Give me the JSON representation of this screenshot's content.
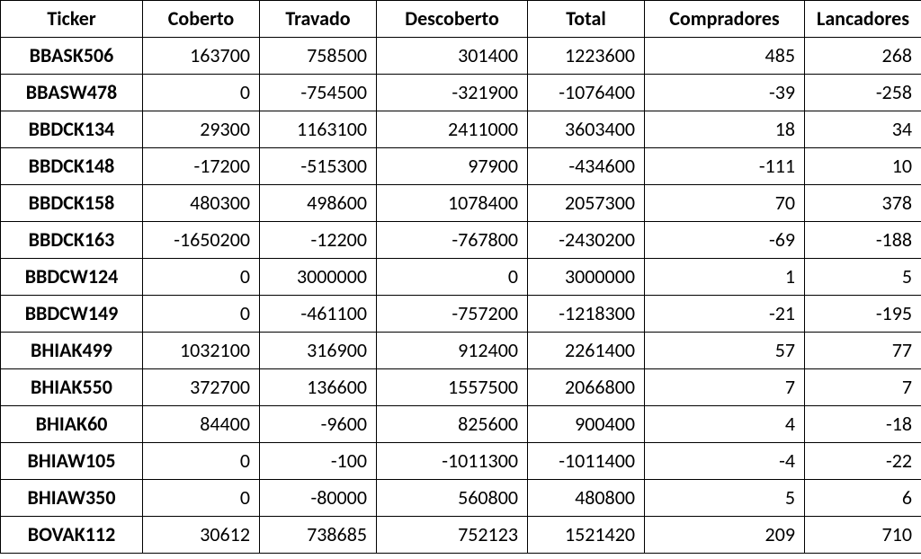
{
  "headers": {
    "ticker": "Ticker",
    "coberto": "Coberto",
    "travado": "Travado",
    "descoberto": "Descoberto",
    "total": "Total",
    "compradores": "Compradores",
    "lancadores": "Lancadores"
  },
  "rows": [
    {
      "ticker": "BBASK506",
      "coberto": "163700",
      "travado": "758500",
      "descoberto": "301400",
      "total": "1223600",
      "compradores": "485",
      "lancadores": "268"
    },
    {
      "ticker": "BBASW478",
      "coberto": "0",
      "travado": "-754500",
      "descoberto": "-321900",
      "total": "-1076400",
      "compradores": "-39",
      "lancadores": "-258"
    },
    {
      "ticker": "BBDCK134",
      "coberto": "29300",
      "travado": "1163100",
      "descoberto": "2411000",
      "total": "3603400",
      "compradores": "18",
      "lancadores": "34"
    },
    {
      "ticker": "BBDCK148",
      "coberto": "-17200",
      "travado": "-515300",
      "descoberto": "97900",
      "total": "-434600",
      "compradores": "-111",
      "lancadores": "10"
    },
    {
      "ticker": "BBDCK158",
      "coberto": "480300",
      "travado": "498600",
      "descoberto": "1078400",
      "total": "2057300",
      "compradores": "70",
      "lancadores": "378"
    },
    {
      "ticker": "BBDCK163",
      "coberto": "-1650200",
      "travado": "-12200",
      "descoberto": "-767800",
      "total": "-2430200",
      "compradores": "-69",
      "lancadores": "-188"
    },
    {
      "ticker": "BBDCW124",
      "coberto": "0",
      "travado": "3000000",
      "descoberto": "0",
      "total": "3000000",
      "compradores": "1",
      "lancadores": "5"
    },
    {
      "ticker": "BBDCW149",
      "coberto": "0",
      "travado": "-461100",
      "descoberto": "-757200",
      "total": "-1218300",
      "compradores": "-21",
      "lancadores": "-195"
    },
    {
      "ticker": "BHIAK499",
      "coberto": "1032100",
      "travado": "316900",
      "descoberto": "912400",
      "total": "2261400",
      "compradores": "57",
      "lancadores": "77"
    },
    {
      "ticker": "BHIAK550",
      "coberto": "372700",
      "travado": "136600",
      "descoberto": "1557500",
      "total": "2066800",
      "compradores": "7",
      "lancadores": "7"
    },
    {
      "ticker": "BHIAK60",
      "coberto": "84400",
      "travado": "-9600",
      "descoberto": "825600",
      "total": "900400",
      "compradores": "4",
      "lancadores": "-18"
    },
    {
      "ticker": "BHIAW105",
      "coberto": "0",
      "travado": "-100",
      "descoberto": "-1011300",
      "total": "-1011400",
      "compradores": "-4",
      "lancadores": "-22"
    },
    {
      "ticker": "BHIAW350",
      "coberto": "0",
      "travado": "-80000",
      "descoberto": "560800",
      "total": "480800",
      "compradores": "5",
      "lancadores": "6"
    },
    {
      "ticker": "BOVAK112",
      "coberto": "30612",
      "travado": "738685",
      "descoberto": "752123",
      "total": "1521420",
      "compradores": "209",
      "lancadores": "710"
    }
  ],
  "chart_data": {
    "type": "table",
    "columns": [
      "Ticker",
      "Coberto",
      "Travado",
      "Descoberto",
      "Total",
      "Compradores",
      "Lancadores"
    ],
    "data": [
      [
        "BBASK506",
        163700,
        758500,
        301400,
        1223600,
        485,
        268
      ],
      [
        "BBASW478",
        0,
        -754500,
        -321900,
        -1076400,
        -39,
        -258
      ],
      [
        "BBDCK134",
        29300,
        1163100,
        2411000,
        3603400,
        18,
        34
      ],
      [
        "BBDCK148",
        -17200,
        -515300,
        97900,
        -434600,
        -111,
        10
      ],
      [
        "BBDCK158",
        480300,
        498600,
        1078400,
        2057300,
        70,
        378
      ],
      [
        "BBDCK163",
        -1650200,
        -12200,
        -767800,
        -2430200,
        -69,
        -188
      ],
      [
        "BBDCW124",
        0,
        3000000,
        0,
        3000000,
        1,
        5
      ],
      [
        "BBDCW149",
        0,
        -461100,
        -757200,
        -1218300,
        -21,
        -195
      ],
      [
        "BHIAK499",
        1032100,
        316900,
        912400,
        2261400,
        57,
        77
      ],
      [
        "BHIAK550",
        372700,
        136600,
        1557500,
        2066800,
        7,
        7
      ],
      [
        "BHIAK60",
        84400,
        -9600,
        825600,
        900400,
        4,
        -18
      ],
      [
        "BHIAW105",
        0,
        -100,
        -1011300,
        -1011400,
        -4,
        -22
      ],
      [
        "BHIAW350",
        0,
        -80000,
        560800,
        480800,
        5,
        6
      ],
      [
        "BOVAK112",
        30612,
        738685,
        752123,
        1521420,
        209,
        710
      ]
    ]
  }
}
